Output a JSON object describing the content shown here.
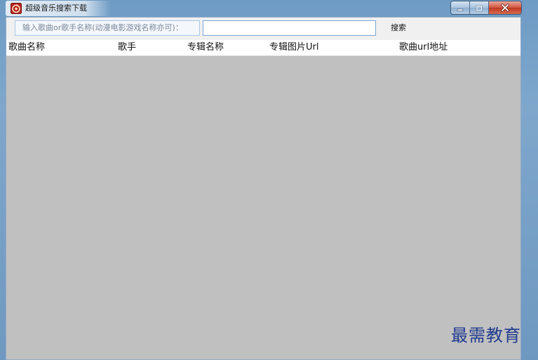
{
  "window": {
    "title": "超级音乐搜索下载",
    "app_icon": "app-logo-icon",
    "buttons": {
      "minimize_icon": "minimize-icon",
      "maximize_icon": "maximize-icon",
      "close_icon": "close-icon"
    }
  },
  "search": {
    "label": "输入歌曲or歌手名称(动漫电影游戏名称亦可)：",
    "input_value": "",
    "button_label": "搜索"
  },
  "table": {
    "columns": [
      "歌曲名称",
      "歌手",
      "专辑名称",
      "专辑图片Url",
      "歌曲url地址"
    ],
    "rows": []
  },
  "watermark": {
    "text": "最需教育"
  },
  "colors": {
    "frame": "#7fa7cc",
    "client_bg": "#f0f0f0",
    "table_body": "#c0c0c0",
    "close_button": "#c94a33",
    "watermark": "#1f3a8f"
  }
}
